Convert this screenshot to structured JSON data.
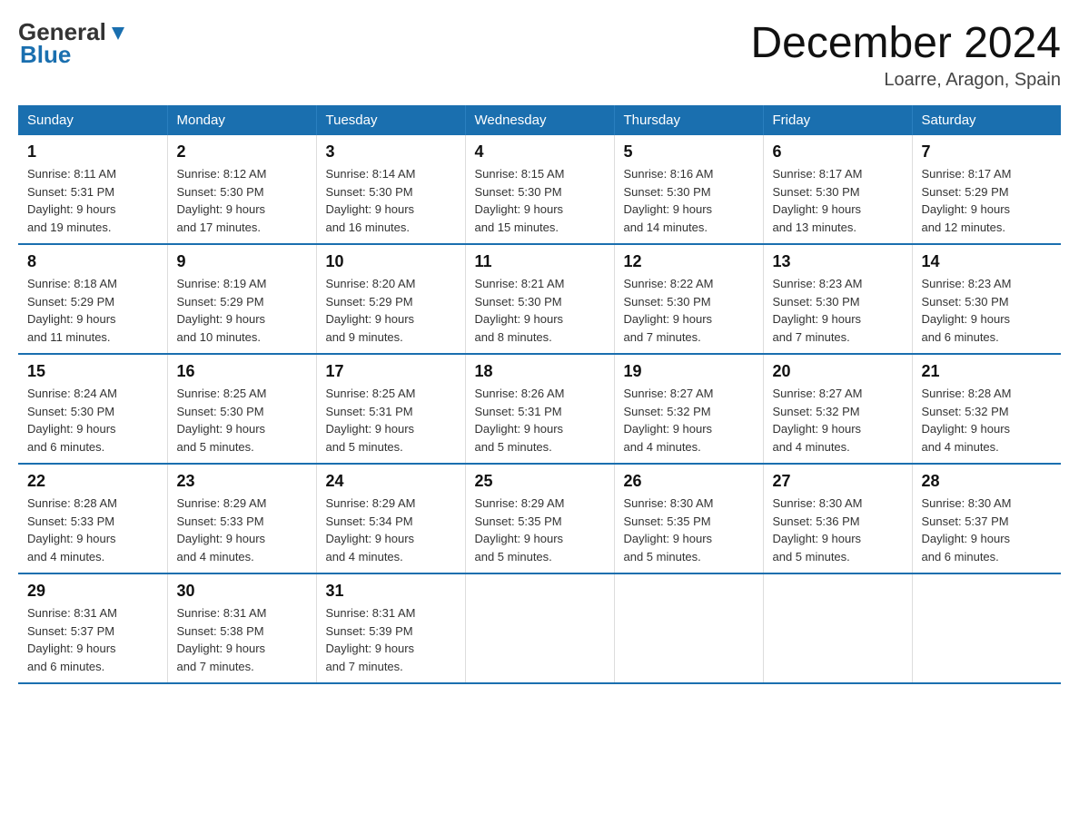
{
  "header": {
    "logo_line1": "General",
    "logo_line2": "Blue",
    "month_title": "December 2024",
    "location": "Loarre, Aragon, Spain"
  },
  "days_of_week": [
    "Sunday",
    "Monday",
    "Tuesday",
    "Wednesday",
    "Thursday",
    "Friday",
    "Saturday"
  ],
  "weeks": [
    [
      {
        "day": "1",
        "sunrise": "8:11 AM",
        "sunset": "5:31 PM",
        "daylight": "9 hours and 19 minutes."
      },
      {
        "day": "2",
        "sunrise": "8:12 AM",
        "sunset": "5:30 PM",
        "daylight": "9 hours and 17 minutes."
      },
      {
        "day": "3",
        "sunrise": "8:14 AM",
        "sunset": "5:30 PM",
        "daylight": "9 hours and 16 minutes."
      },
      {
        "day": "4",
        "sunrise": "8:15 AM",
        "sunset": "5:30 PM",
        "daylight": "9 hours and 15 minutes."
      },
      {
        "day": "5",
        "sunrise": "8:16 AM",
        "sunset": "5:30 PM",
        "daylight": "9 hours and 14 minutes."
      },
      {
        "day": "6",
        "sunrise": "8:17 AM",
        "sunset": "5:30 PM",
        "daylight": "9 hours and 13 minutes."
      },
      {
        "day": "7",
        "sunrise": "8:17 AM",
        "sunset": "5:29 PM",
        "daylight": "9 hours and 12 minutes."
      }
    ],
    [
      {
        "day": "8",
        "sunrise": "8:18 AM",
        "sunset": "5:29 PM",
        "daylight": "9 hours and 11 minutes."
      },
      {
        "day": "9",
        "sunrise": "8:19 AM",
        "sunset": "5:29 PM",
        "daylight": "9 hours and 10 minutes."
      },
      {
        "day": "10",
        "sunrise": "8:20 AM",
        "sunset": "5:29 PM",
        "daylight": "9 hours and 9 minutes."
      },
      {
        "day": "11",
        "sunrise": "8:21 AM",
        "sunset": "5:30 PM",
        "daylight": "9 hours and 8 minutes."
      },
      {
        "day": "12",
        "sunrise": "8:22 AM",
        "sunset": "5:30 PM",
        "daylight": "9 hours and 7 minutes."
      },
      {
        "day": "13",
        "sunrise": "8:23 AM",
        "sunset": "5:30 PM",
        "daylight": "9 hours and 7 minutes."
      },
      {
        "day": "14",
        "sunrise": "8:23 AM",
        "sunset": "5:30 PM",
        "daylight": "9 hours and 6 minutes."
      }
    ],
    [
      {
        "day": "15",
        "sunrise": "8:24 AM",
        "sunset": "5:30 PM",
        "daylight": "9 hours and 6 minutes."
      },
      {
        "day": "16",
        "sunrise": "8:25 AM",
        "sunset": "5:30 PM",
        "daylight": "9 hours and 5 minutes."
      },
      {
        "day": "17",
        "sunrise": "8:25 AM",
        "sunset": "5:31 PM",
        "daylight": "9 hours and 5 minutes."
      },
      {
        "day": "18",
        "sunrise": "8:26 AM",
        "sunset": "5:31 PM",
        "daylight": "9 hours and 5 minutes."
      },
      {
        "day": "19",
        "sunrise": "8:27 AM",
        "sunset": "5:32 PM",
        "daylight": "9 hours and 4 minutes."
      },
      {
        "day": "20",
        "sunrise": "8:27 AM",
        "sunset": "5:32 PM",
        "daylight": "9 hours and 4 minutes."
      },
      {
        "day": "21",
        "sunrise": "8:28 AM",
        "sunset": "5:32 PM",
        "daylight": "9 hours and 4 minutes."
      }
    ],
    [
      {
        "day": "22",
        "sunrise": "8:28 AM",
        "sunset": "5:33 PM",
        "daylight": "9 hours and 4 minutes."
      },
      {
        "day": "23",
        "sunrise": "8:29 AM",
        "sunset": "5:33 PM",
        "daylight": "9 hours and 4 minutes."
      },
      {
        "day": "24",
        "sunrise": "8:29 AM",
        "sunset": "5:34 PM",
        "daylight": "9 hours and 4 minutes."
      },
      {
        "day": "25",
        "sunrise": "8:29 AM",
        "sunset": "5:35 PM",
        "daylight": "9 hours and 5 minutes."
      },
      {
        "day": "26",
        "sunrise": "8:30 AM",
        "sunset": "5:35 PM",
        "daylight": "9 hours and 5 minutes."
      },
      {
        "day": "27",
        "sunrise": "8:30 AM",
        "sunset": "5:36 PM",
        "daylight": "9 hours and 5 minutes."
      },
      {
        "day": "28",
        "sunrise": "8:30 AM",
        "sunset": "5:37 PM",
        "daylight": "9 hours and 6 minutes."
      }
    ],
    [
      {
        "day": "29",
        "sunrise": "8:31 AM",
        "sunset": "5:37 PM",
        "daylight": "9 hours and 6 minutes."
      },
      {
        "day": "30",
        "sunrise": "8:31 AM",
        "sunset": "5:38 PM",
        "daylight": "9 hours and 7 minutes."
      },
      {
        "day": "31",
        "sunrise": "8:31 AM",
        "sunset": "5:39 PM",
        "daylight": "9 hours and 7 minutes."
      },
      null,
      null,
      null,
      null
    ]
  ]
}
